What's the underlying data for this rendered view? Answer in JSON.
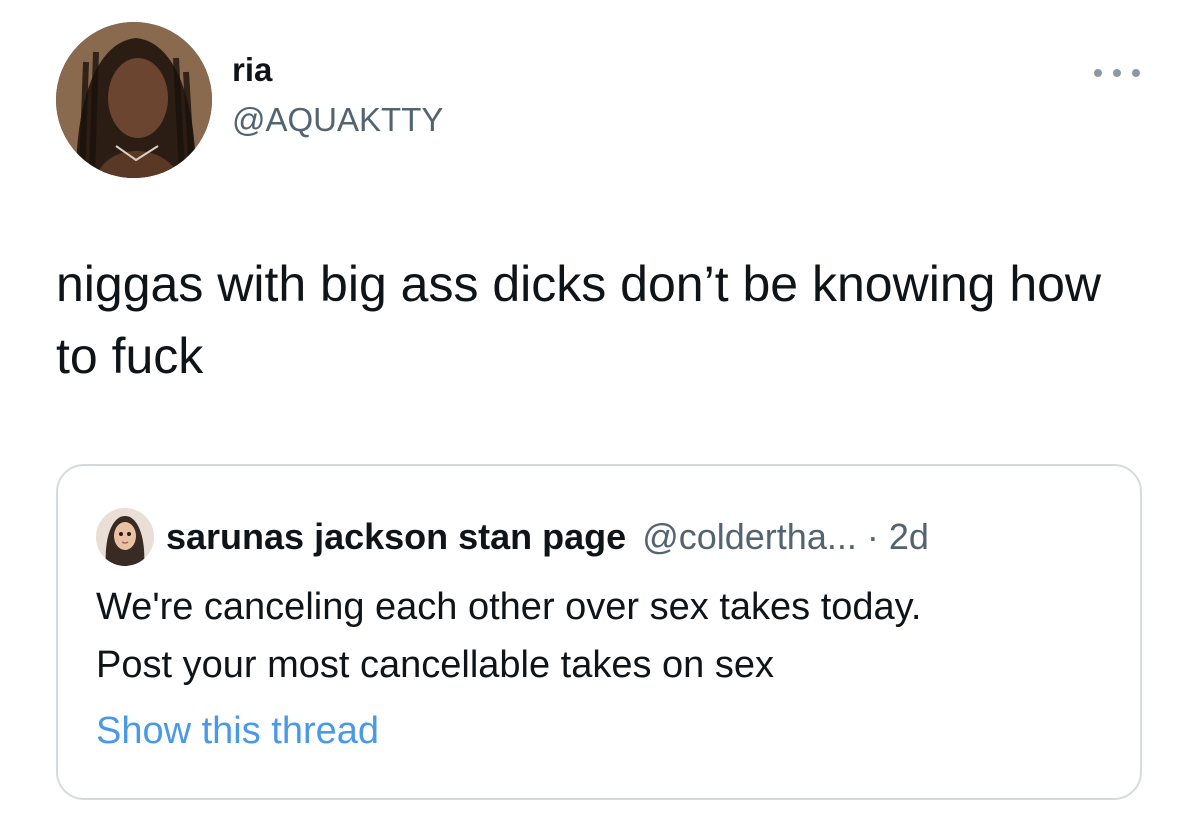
{
  "tweet": {
    "author": {
      "display_name": "ria",
      "handle": "@AQUAKTTY",
      "avatar_icon": "profile-photo"
    },
    "more_icon": "more-horizontal-icon",
    "text": "niggas with big ass dicks don’t be knowing how to fuck"
  },
  "quoted_tweet": {
    "author": {
      "display_name": "sarunas jackson stan page",
      "handle": "@coldertha...",
      "avatar_icon": "profile-photo"
    },
    "separator": "·",
    "timestamp": "2d",
    "text_lines": [
      "We're canceling each other over sex takes today.",
      "Post your most cancellable takes on sex"
    ],
    "show_thread_label": "Show this thread"
  },
  "colors": {
    "text_primary": "#0f1419",
    "text_secondary": "#536471",
    "link": "#4a99e9",
    "border": "#d6dbe0"
  }
}
